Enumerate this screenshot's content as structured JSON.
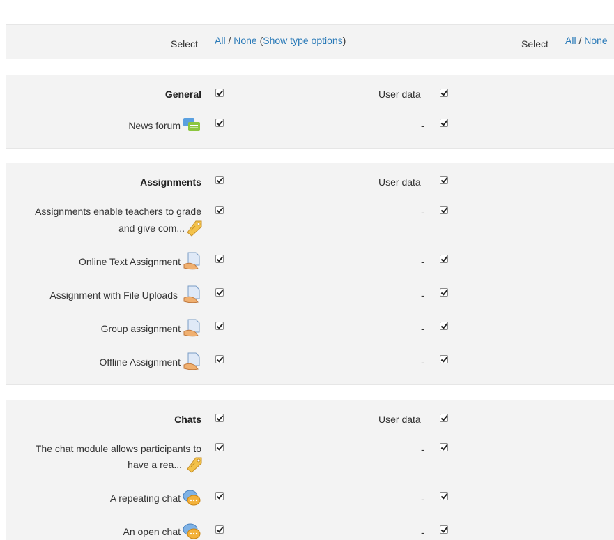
{
  "select_bar": {
    "left_label": "Select",
    "all": "All",
    "slash": "/",
    "none": "None",
    "paren_open": "(",
    "show_type_options": "Show type options",
    "paren_close": ")",
    "right_label": "Select",
    "right_all": "All",
    "right_slash": "/",
    "right_none": "None"
  },
  "sections": {
    "general": {
      "title": "General",
      "user_data": "User data",
      "items": [
        {
          "label": "News forum",
          "user_data": "-",
          "icon": "forum-icon",
          "checked": true,
          "user_checked": true
        }
      ]
    },
    "assignments": {
      "title": "Assignments",
      "user_data": "User data",
      "items": [
        {
          "label_line1": "Assignments enable teachers to grade",
          "label_line2": "and give com...",
          "user_data": "-",
          "icon": "tag-icon",
          "checked": true,
          "user_checked": true
        },
        {
          "label": "Online Text Assignment",
          "user_data": "-",
          "icon": "assignment-icon",
          "checked": true,
          "user_checked": true
        },
        {
          "label": "Assignment with File Uploads",
          "user_data": "-",
          "icon": "assignment-icon",
          "checked": true,
          "user_checked": true
        },
        {
          "label": "Group assignment",
          "user_data": "-",
          "icon": "assignment-icon",
          "checked": true,
          "user_checked": true
        },
        {
          "label": "Offline Assignment",
          "user_data": "-",
          "icon": "assignment-icon",
          "checked": true,
          "user_checked": true
        }
      ]
    },
    "chats": {
      "title": "Chats",
      "user_data": "User data",
      "items": [
        {
          "label_line1": "The chat module allows participants to",
          "label_line2": "have a rea...",
          "user_data": "-",
          "icon": "tag-icon",
          "checked": true,
          "user_checked": true
        },
        {
          "label": "A repeating chat",
          "user_data": "-",
          "icon": "chat-icon",
          "checked": true,
          "user_checked": true
        },
        {
          "label": "An open chat",
          "user_data": "-",
          "icon": "chat-icon",
          "checked": true,
          "user_checked": true
        }
      ]
    }
  },
  "colors": {
    "link": "#2a7ab8",
    "band": "#f3f3f3",
    "text": "#333333"
  }
}
